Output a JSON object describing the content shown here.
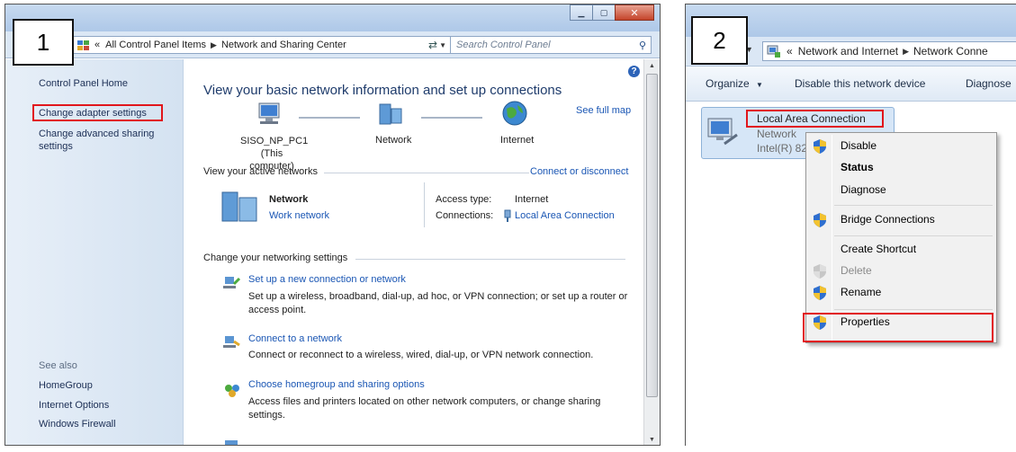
{
  "step_labels": [
    "1",
    "2"
  ],
  "panel1": {
    "address": {
      "back_chevron": "«",
      "crumbs": [
        "All Control Panel Items",
        "Network and Sharing Center"
      ]
    },
    "search_placeholder": "Search Control Panel",
    "sidebar": {
      "home": "Control Panel Home",
      "change_adapter": "Change adapter settings",
      "change_advanced": "Change advanced sharing settings",
      "see_also": "See also",
      "links": [
        "HomeGroup",
        "Internet Options",
        "Windows Firewall"
      ]
    },
    "heading": "View your basic network information and set up connections",
    "see_full_map": "See full map",
    "map": {
      "computer_name": "SISO_NP_PC1",
      "computer_sub": "(This computer)",
      "network": "Network",
      "internet": "Internet"
    },
    "active_networks": {
      "label": "View your active networks",
      "connect_link": "Connect or disconnect",
      "network_name": "Network",
      "network_type": "Work network",
      "access_type_label": "Access type:",
      "access_type_value": "Internet",
      "connections_label": "Connections:",
      "connections_value": "Local Area Connection"
    },
    "settings": {
      "label": "Change your networking settings",
      "items": [
        {
          "link": "Set up a new connection or network",
          "desc1": "Set up a wireless, broadband, dial-up, ad hoc, or VPN connection; or set up a router or",
          "desc2": "access point."
        },
        {
          "link": "Connect to a network",
          "desc1": "Connect or reconnect to a wireless, wired, dial-up, or VPN network connection.",
          "desc2": ""
        },
        {
          "link": "Choose homegroup and sharing options",
          "desc1": "Access files and printers located on other network computers, or change sharing",
          "desc2": "settings."
        }
      ]
    }
  },
  "panel2": {
    "address": {
      "back_chevron": "«",
      "crumbs": [
        "Network and Internet",
        "Network Conne"
      ]
    },
    "toolbar": {
      "organize": "Organize",
      "disable_device": "Disable this network device",
      "diagnose": "Diagnose"
    },
    "adapter": {
      "name": "Local Area Connection",
      "status": "Network",
      "device": "Intel(R) 82"
    },
    "context_menu": [
      {
        "label": "Disable",
        "shield": true,
        "bold": false,
        "disabled": false
      },
      {
        "label": "Status",
        "shield": false,
        "bold": true,
        "disabled": false
      },
      {
        "label": "Diagnose",
        "shield": false,
        "bold": false,
        "disabled": false
      },
      {
        "label": "Bridge Connections",
        "shield": true,
        "bold": false,
        "disabled": false
      },
      {
        "label": "Create Shortcut",
        "shield": false,
        "bold": false,
        "disabled": false
      },
      {
        "label": "Delete",
        "shield": true,
        "bold": false,
        "disabled": true
      },
      {
        "label": "Rename",
        "shield": true,
        "bold": false,
        "disabled": false
      },
      {
        "label": "Properties",
        "shield": true,
        "bold": false,
        "disabled": false
      }
    ]
  },
  "colors": {
    "highlight": "#e1161c",
    "link": "#1a56b4"
  }
}
